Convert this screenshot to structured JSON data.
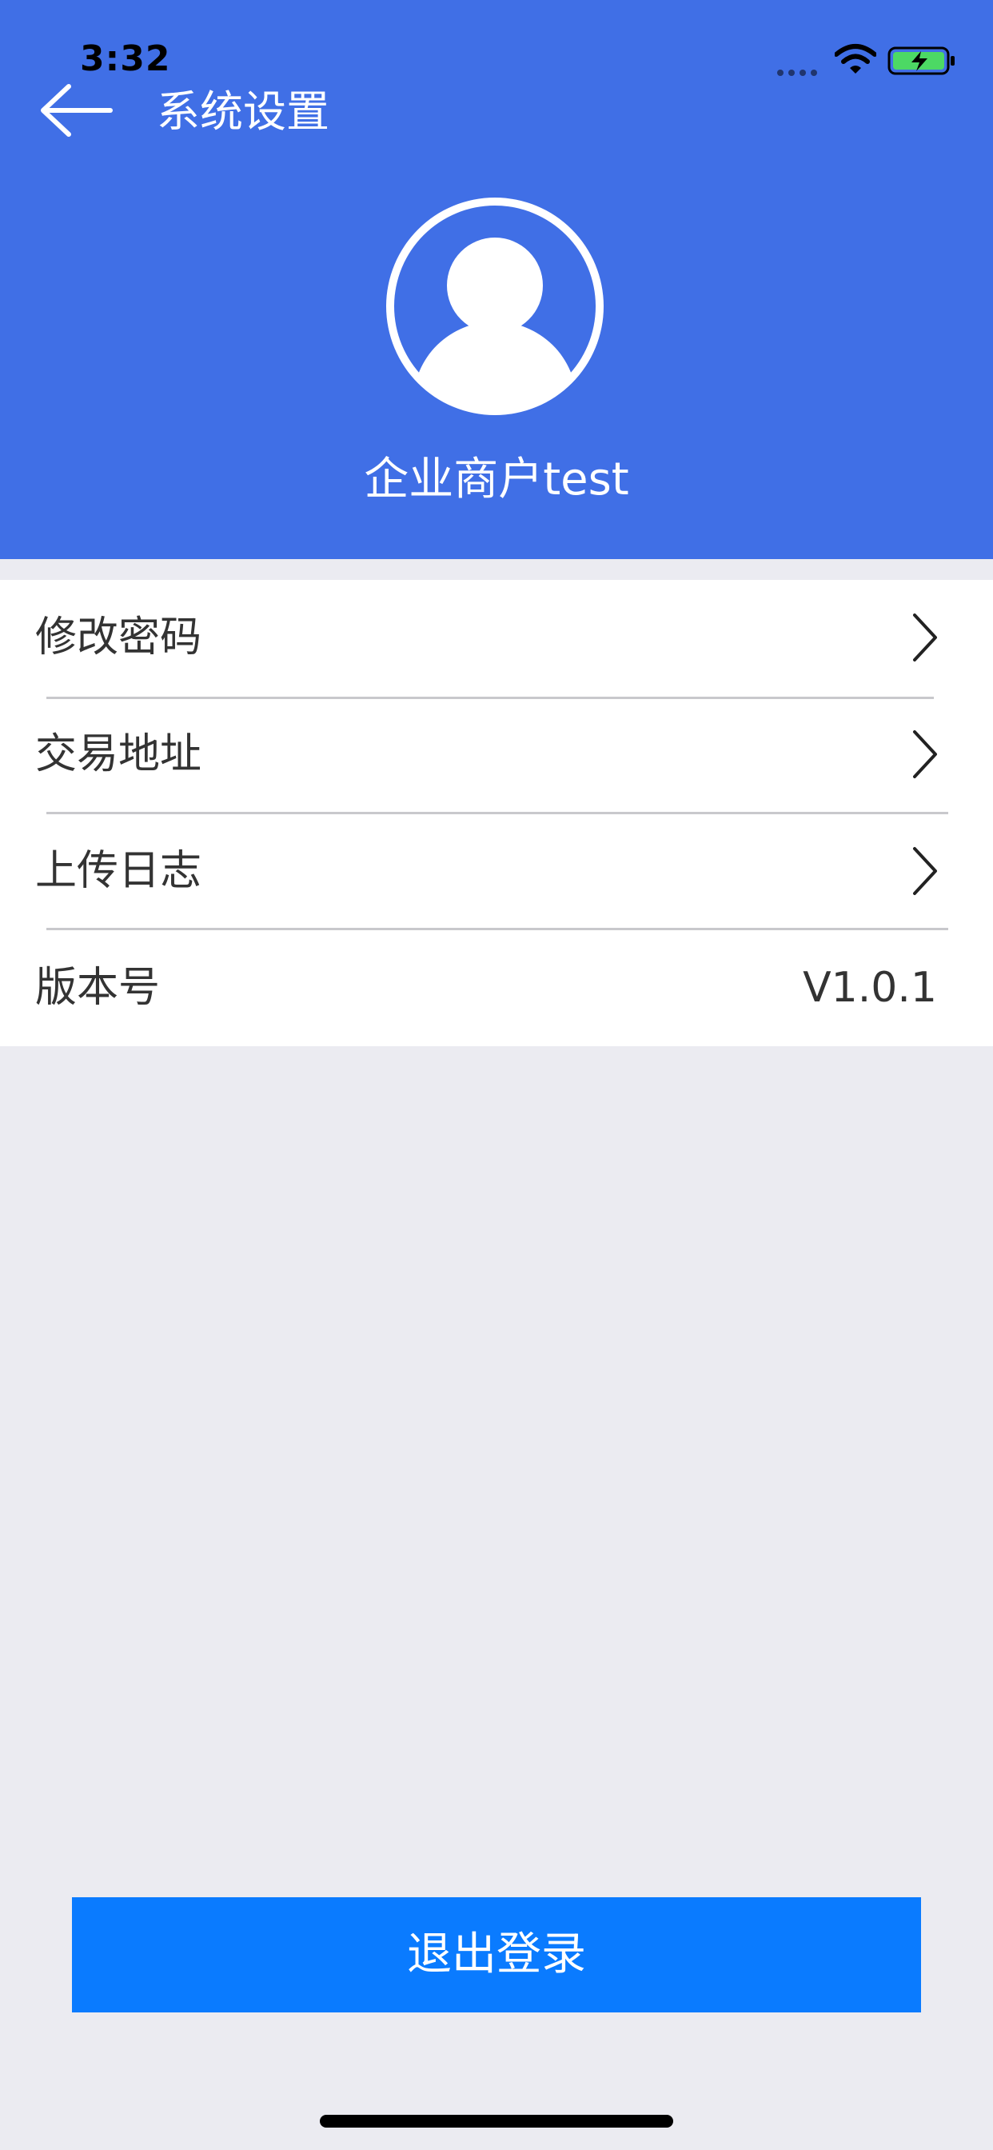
{
  "status_bar": {
    "time": "3:32",
    "wifi_icon": "wifi-icon",
    "battery_icon": "battery-charging-icon"
  },
  "header": {
    "back_icon": "arrow-left-icon",
    "title": "系统设置",
    "avatar_icon": "user-avatar-icon",
    "account_name": "企业商户test",
    "background_color": "#406fe6"
  },
  "settings": {
    "items": [
      {
        "label": "修改密码",
        "icon": "chevron-right-icon"
      },
      {
        "label": "交易地址",
        "icon": "chevron-right-icon"
      },
      {
        "label": "上传日志",
        "icon": "chevron-right-icon"
      },
      {
        "label": "版本号",
        "value": "V1.0.1"
      }
    ]
  },
  "logout": {
    "label": "退出登录",
    "color": "#0a7bff"
  }
}
